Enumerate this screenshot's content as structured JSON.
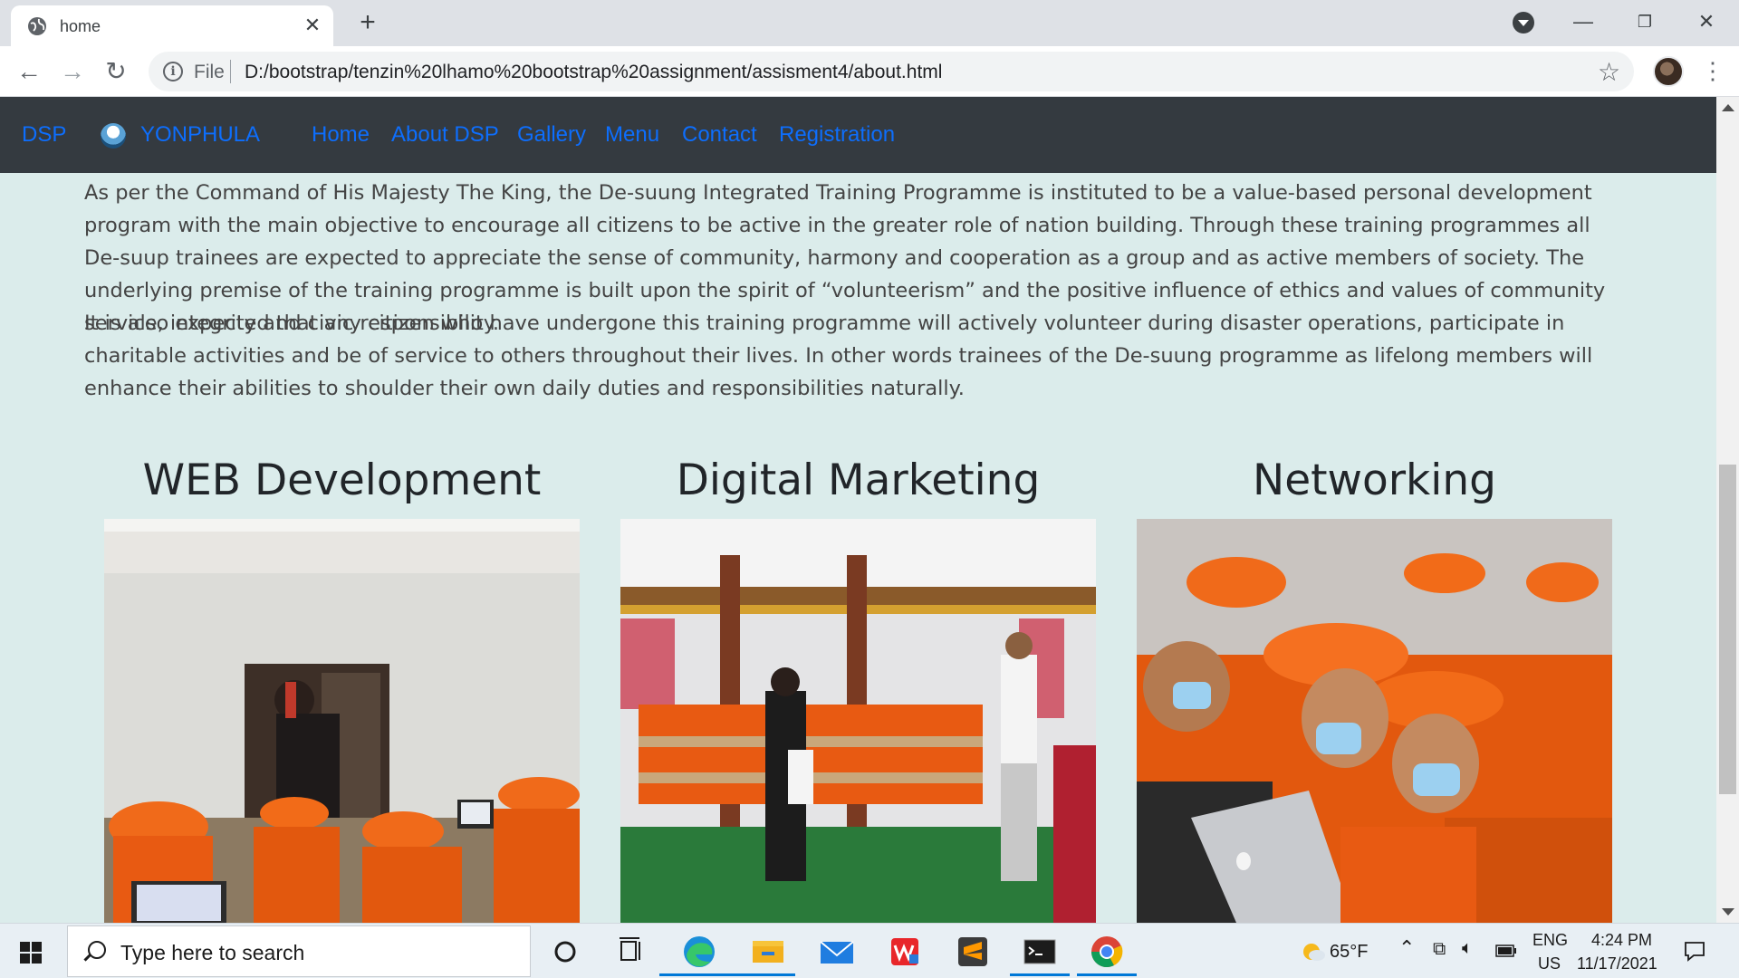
{
  "browser": {
    "tab_title": "home",
    "url_scheme": "File",
    "url": "D:/bootstrap/tenzin%20lhamo%20bootstrap%20assignment/assisment4/about.html"
  },
  "navbar": {
    "brand": "DSP",
    "logo_text": "YONPHULA",
    "links": [
      "Home",
      "About DSP",
      "Gallery",
      "Menu",
      "Contact",
      "Registration"
    ],
    "link_color": "#0d6efd",
    "bg_color": "#343a40"
  },
  "content": {
    "paragraph1": "As per the Command of His Majesty The King, the De-suung Integrated Training Programme is instituted to be a value-based personal development program with the main objective to encourage all citizens to be active in the greater role of nation building. Through these training programmes all De-suup trainees are expected to appreciate the sense of community, harmony and cooperation as a group and as active members of society. The underlying premise of the training programme is built upon the spirit of “volunteerism” and the positive influence of ethics and values of community service, integrity and civic responsibility.",
    "paragraph2": "It is also expected that any citizen who have undergone this training programme will actively volunteer during disaster operations, participate in charitable activities and be of service to others throughout their lives. In other words trainees of the De-suung programme as lifelong members will enhance their abilities to shoulder their own daily duties and responsibilities naturally.",
    "cards": [
      {
        "title": "WEB Development"
      },
      {
        "title": "Digital Marketing"
      },
      {
        "title": "Networking"
      }
    ],
    "bg_color": "#dbeceb"
  },
  "taskbar": {
    "search_placeholder": "Type here to search",
    "weather": "65°F",
    "lang_top": "ENG",
    "lang_bottom": "US",
    "time": "4:24 PM",
    "date": "11/17/2021"
  }
}
